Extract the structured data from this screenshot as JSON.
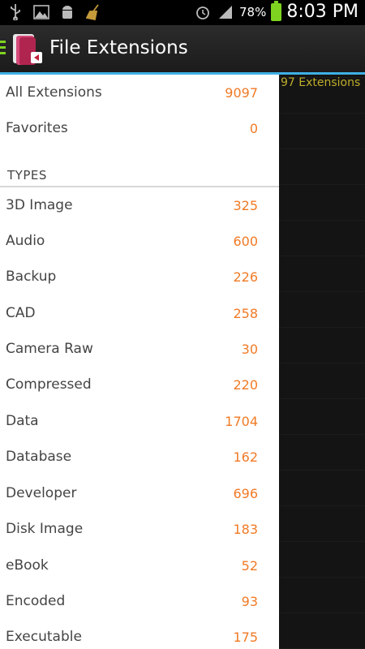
{
  "status_bar": {
    "battery_percent": "78%",
    "time": "8:03 PM",
    "left_icons": [
      "usb-icon",
      "image-icon",
      "android-icon",
      "broom-icon"
    ],
    "right_icons": [
      "alarm-icon",
      "signal-icon",
      "battery-charging-icon"
    ]
  },
  "action_bar": {
    "title": "File Extensions",
    "accent_color": "#3fb0e5"
  },
  "background": {
    "count_text": "97 Extensions"
  },
  "drawer": {
    "top_items": [
      {
        "label": "All Extensions",
        "count": "9097"
      },
      {
        "label": "Favorites",
        "count": "0"
      }
    ],
    "section_title": "TYPES",
    "types": [
      {
        "label": "3D Image",
        "count": "325"
      },
      {
        "label": "Audio",
        "count": "600"
      },
      {
        "label": "Backup",
        "count": "226"
      },
      {
        "label": "CAD",
        "count": "258"
      },
      {
        "label": "Camera Raw",
        "count": "30"
      },
      {
        "label": "Compressed",
        "count": "220"
      },
      {
        "label": "Data",
        "count": "1704"
      },
      {
        "label": "Database",
        "count": "162"
      },
      {
        "label": "Developer",
        "count": "696"
      },
      {
        "label": "Disk Image",
        "count": "183"
      },
      {
        "label": "eBook",
        "count": "52"
      },
      {
        "label": "Encoded",
        "count": "93"
      },
      {
        "label": "Executable",
        "count": "175"
      }
    ],
    "count_color": "#f07a25"
  }
}
